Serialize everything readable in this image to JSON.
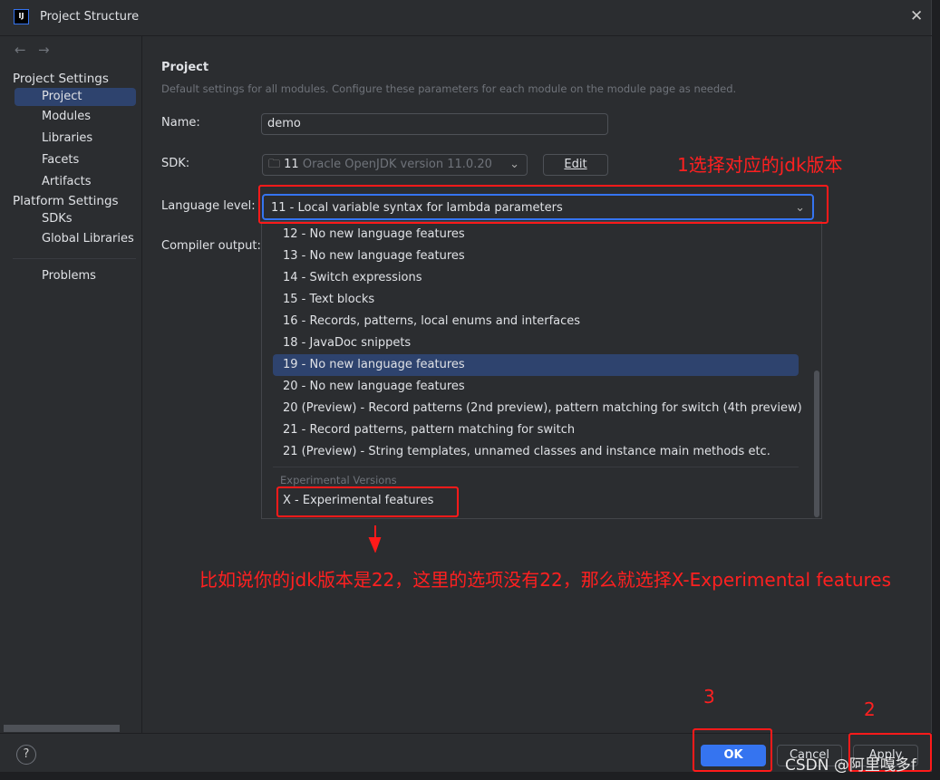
{
  "window": {
    "title": "Project Structure",
    "logo_text": "IJ",
    "close_icon": "close-icon"
  },
  "sidebar": {
    "nav_back": "←",
    "nav_forward": "→",
    "project_settings_header": "Project Settings",
    "project_items": [
      {
        "label": "Project",
        "selected": true
      },
      {
        "label": "Modules"
      },
      {
        "label": "Libraries"
      },
      {
        "label": "Facets"
      },
      {
        "label": "Artifacts"
      }
    ],
    "platform_settings_header": "Platform Settings",
    "platform_items": [
      {
        "label": "SDKs"
      },
      {
        "label": "Global Libraries"
      }
    ],
    "problems": "Problems"
  },
  "main": {
    "title": "Project",
    "description": "Default settings for all modules. Configure these parameters for each module on the module page as needed.",
    "name_label": "Name:",
    "name_value": "demo",
    "sdk_label": "SDK:",
    "sdk_version": "11",
    "sdk_name": "Oracle OpenJDK version 11.0.20",
    "edit_button": "Edit",
    "language_level_label": "Language level:",
    "language_level_value": "11 - Local variable syntax for lambda parameters",
    "compiler_output_label": "Compiler output:"
  },
  "dropdown": {
    "options": [
      "12 - No new language features",
      "13 - No new language features",
      "14 - Switch expressions",
      "15 - Text blocks",
      "16 - Records, patterns, local enums and interfaces",
      "18 - JavaDoc snippets",
      "19 - No new language features",
      "20 - No new language features",
      "20 (Preview) - Record patterns (2nd preview), pattern matching for switch (4th preview)",
      "21 - Record patterns, pattern matching for switch",
      "21 (Preview) - String templates, unnamed classes and instance main methods etc."
    ],
    "highlighted_index": 6,
    "experimental_header": "Experimental Versions",
    "experimental_option": "X - Experimental features"
  },
  "footer": {
    "help": "?",
    "ok": "OK",
    "cancel": "Cancel",
    "apply": "Apply"
  },
  "annotations": {
    "note1": "1选择对应的jdk版本",
    "note_main": "比如说你的jdk版本是22，这里的选项没有22，那么就选择X-Experimental features",
    "step2": "2",
    "step3": "3"
  },
  "watermark": "CSDN @阿里嘎多f",
  "colors": {
    "accent": "#3574f0",
    "annotation": "#ff1a1a",
    "selection": "#2e436e",
    "background": "#2b2d30"
  }
}
